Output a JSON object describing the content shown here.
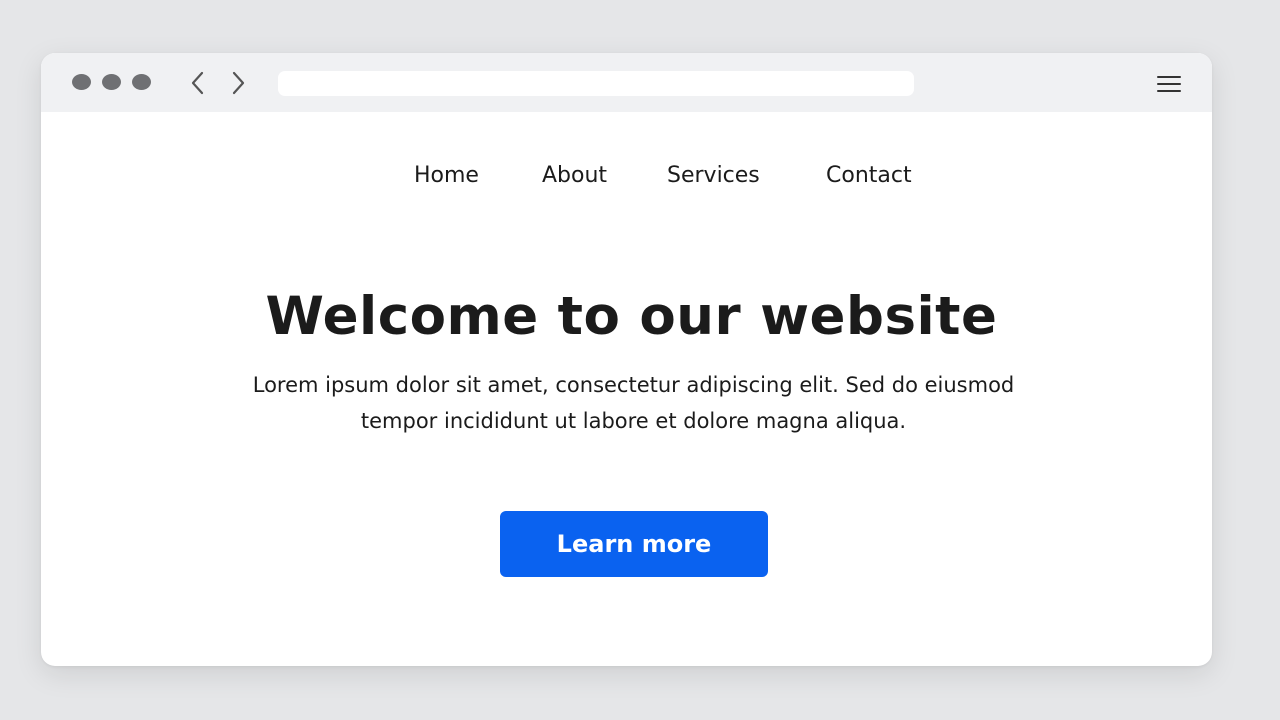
{
  "browser": {
    "window_controls": [
      "dot",
      "dot",
      "dot"
    ],
    "back_icon": "chevron-left-icon",
    "forward_icon": "chevron-right-icon",
    "address_value": "",
    "menu_icon": "hamburger-menu-icon"
  },
  "nav": {
    "items": [
      {
        "label": "Home"
      },
      {
        "label": "About"
      },
      {
        "label": "Services"
      },
      {
        "label": "Contact"
      }
    ]
  },
  "hero": {
    "title": "Welcome to our website",
    "text": "Lorem ipsum dolor sit amet, consectetur adipiscing elit. Sed do eiusmod tempor incididunt ut labore et dolore magna aliqua.",
    "button_label": "Learn more"
  },
  "colors": {
    "accent": "#0a62f0",
    "background": "#e5e6e8",
    "titlebar": "#f0f1f3",
    "text": "#1b1b1b"
  }
}
